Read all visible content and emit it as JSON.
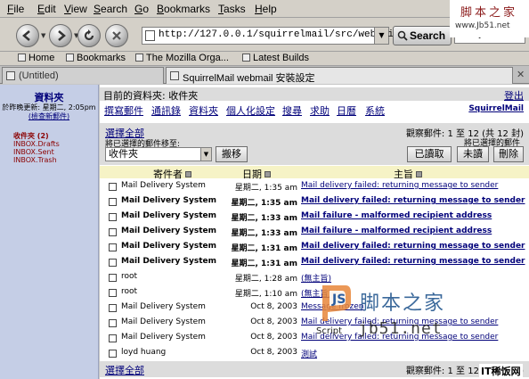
{
  "menubar": {
    "items": [
      "File",
      "Edit",
      "View",
      "Search",
      "Go",
      "Bookmarks",
      "Tasks",
      "Help"
    ]
  },
  "navbar": {
    "url": "http://127.0.0.1/squirrelmail/src/webmail.php",
    "search_label": "Search",
    "site_label": "www.Jb51.net"
  },
  "bookmarks": {
    "items": [
      "Home",
      "Bookmarks",
      "The Mozilla Orga...",
      "Latest Builds"
    ]
  },
  "tabs": [
    {
      "label": "(Untitled)",
      "active": false
    },
    {
      "label": "SquirrelMail webmail 安裝設定",
      "active": true
    }
  ],
  "sidebar": {
    "title": "資料夾",
    "updated": "於昨晚更新: 星期二, 2:05pm",
    "check_mail": "(檢查新郵件)",
    "folders": [
      {
        "label": "收件夾 (2)",
        "current": true
      },
      {
        "label": "INBOX.Drafts",
        "current": false
      },
      {
        "label": "INBOX.Sent",
        "current": false
      },
      {
        "label": "INBOX.Trash",
        "current": false
      }
    ]
  },
  "main": {
    "current_folder": "目前的資料夾: 收件夾",
    "logout": "登出",
    "links": [
      "撰寫郵件",
      "通訊錄",
      "資料夾",
      "個人化設定",
      "搜尋",
      "求助",
      "日曆",
      "系統"
    ],
    "brand": "SquirrelMail",
    "select_all": "選擇全部",
    "viewing": "觀察郵件: 1 至 12 (共 12 封)",
    "move_label": "將已選擇的郵件移至:",
    "mark_label": "將已選擇的郵件",
    "folder_select": "收件夾",
    "move_button": "搬移",
    "read_button": "已讀取",
    "unread_button": "未讀",
    "delete_button": "刪除",
    "columns": {
      "from": "寄件者",
      "date": "日期",
      "subject": "主旨"
    },
    "messages": [
      {
        "from": "Mail Delivery System",
        "date": "星期二, 1:35 am",
        "subject": "Mail delivery failed: returning message to sender",
        "unseen": false
      },
      {
        "from": "Mail Delivery System",
        "date": "星期二, 1:35 am",
        "subject": "Mail delivery failed: returning message to sender",
        "unseen": true
      },
      {
        "from": "Mail Delivery System",
        "date": "星期二, 1:33 am",
        "subject": "Mail failure - malformed recipient address",
        "unseen": true
      },
      {
        "from": "Mail Delivery System",
        "date": "星期二, 1:33 am",
        "subject": "Mail failure - malformed recipient address",
        "unseen": true
      },
      {
        "from": "Mail Delivery System",
        "date": "星期二, 1:31 am",
        "subject": "Mail delivery failed: returning message to sender",
        "unseen": true
      },
      {
        "from": "Mail Delivery System",
        "date": "星期二, 1:31 am",
        "subject": "Mail delivery failed: returning message to sender",
        "unseen": true
      },
      {
        "from": "root",
        "date": "星期二, 1:28 am",
        "subject": "(無主旨)",
        "unseen": false
      },
      {
        "from": "root",
        "date": "星期二, 1:10 am",
        "subject": "(無主旨)",
        "unseen": false
      },
      {
        "from": "Mail Delivery System",
        "date": "Oct 8, 2003",
        "subject": "Message frozen",
        "unseen": false
      },
      {
        "from": "Mail Delivery System",
        "date": "Oct 8, 2003",
        "subject": "Mail delivery failed: returning message to sender",
        "unseen": false
      },
      {
        "from": "Mail Delivery System",
        "date": "Oct 8, 2003",
        "subject": "Mail delivery failed: returning message to sender",
        "unseen": false
      },
      {
        "from": "loyd huang",
        "date": "Oct 8, 2003",
        "subject": "測試",
        "unseen": false
      }
    ],
    "viewing_bottom": "觀察郵件: 1 至 12 (共 12 封)"
  },
  "watermark": {
    "top_text": "脚本之家",
    "top_url": "www.Jb51.net",
    "logo_caption": "Script",
    "big_text": "脚本之家",
    "big_url": "jb51.net",
    "bottom_text": "IT稀饭网"
  }
}
